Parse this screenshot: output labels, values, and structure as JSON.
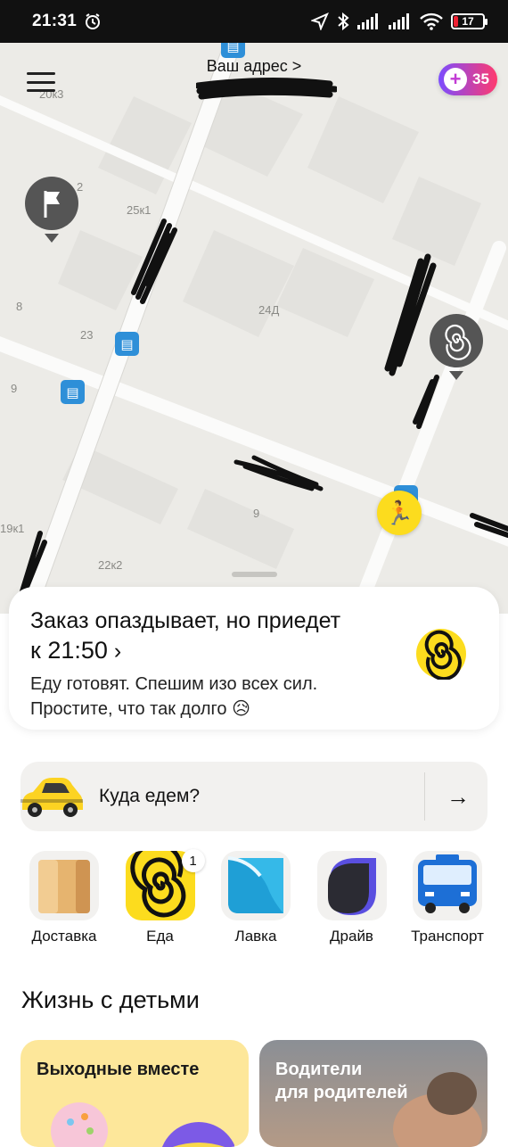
{
  "status_bar": {
    "time": "21:31",
    "battery": "17"
  },
  "map": {
    "address_label": "Ваш адрес >",
    "plus_points": "35",
    "house_labels": [
      "20к3",
      "25к1",
      "8",
      "23",
      "24Д",
      "9",
      "9",
      "19к1",
      "22к2",
      "2"
    ]
  },
  "order": {
    "title": "Заказ опаздывает, но приедет",
    "time_line": "к 21:50",
    "chevron": "›",
    "subtitle_line1": "Еду готовят. Спешим изо всех сил.",
    "subtitle_line2": "Простите, что так долго 😥"
  },
  "search": {
    "label": "Куда едем?",
    "arrow": "→"
  },
  "services": [
    {
      "label": "Доставка"
    },
    {
      "label": "Еда",
      "badge": "1"
    },
    {
      "label": "Лавка"
    },
    {
      "label": "Драйв"
    },
    {
      "label": "Транспорт"
    }
  ],
  "section": {
    "title": "Жизнь с детьми"
  },
  "promos": [
    {
      "title_line1": "Выходные вместе"
    },
    {
      "title_line1": "Водители",
      "title_line2": "для родителей"
    }
  ],
  "colors": {
    "accent_yellow": "#fcdc1e",
    "plus_gradient_start": "#7b4cff",
    "plus_gradient_end": "#ff3a6e",
    "stop_blue": "#2e8fd8"
  }
}
